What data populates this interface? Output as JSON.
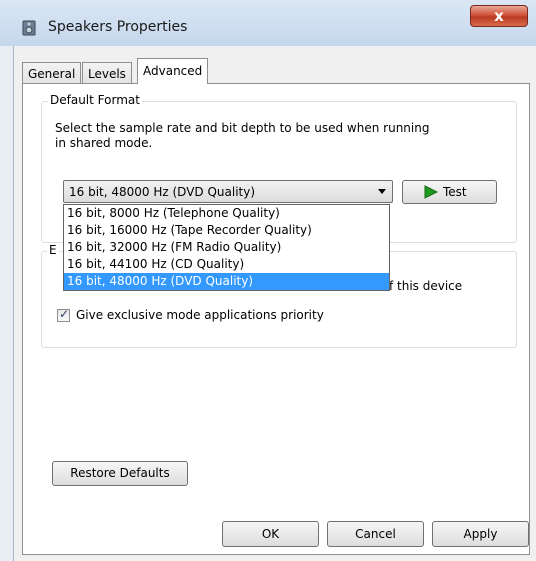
{
  "window": {
    "title": "Speakers Properties",
    "close_label": "x"
  },
  "tabs": [
    {
      "label": "General",
      "active": false
    },
    {
      "label": "Levels",
      "active": false
    },
    {
      "label": "Advanced",
      "active": true
    }
  ],
  "default_format": {
    "group_label": "Default Format",
    "description_line1": "Select the sample rate and bit depth to be used when running",
    "description_line2": "in shared mode.",
    "selected_value": "16 bit, 48000 Hz (DVD Quality)",
    "test_label": "Test",
    "options": [
      {
        "label": "16 bit, 8000 Hz (Telephone Quality)",
        "selected": false
      },
      {
        "label": "16 bit, 16000 Hz (Tape Recorder Quality)",
        "selected": false
      },
      {
        "label": "16 bit, 32000 Hz (FM Radio Quality)",
        "selected": false
      },
      {
        "label": "16 bit, 44100 Hz (CD Quality)",
        "selected": false
      },
      {
        "label": "16 bit, 48000 Hz (DVD Quality)",
        "selected": true
      }
    ]
  },
  "exclusive_mode": {
    "group_label_visible": "E",
    "partial_text_visible": "f this device",
    "priority_label": "Give exclusive mode applications priority",
    "priority_checked": true
  },
  "buttons": {
    "restore_defaults": "Restore Defaults",
    "ok": "OK",
    "cancel": "Cancel",
    "apply": "Apply"
  },
  "colors": {
    "selection": "#3399ff",
    "test_icon": "#1f9a1f"
  }
}
